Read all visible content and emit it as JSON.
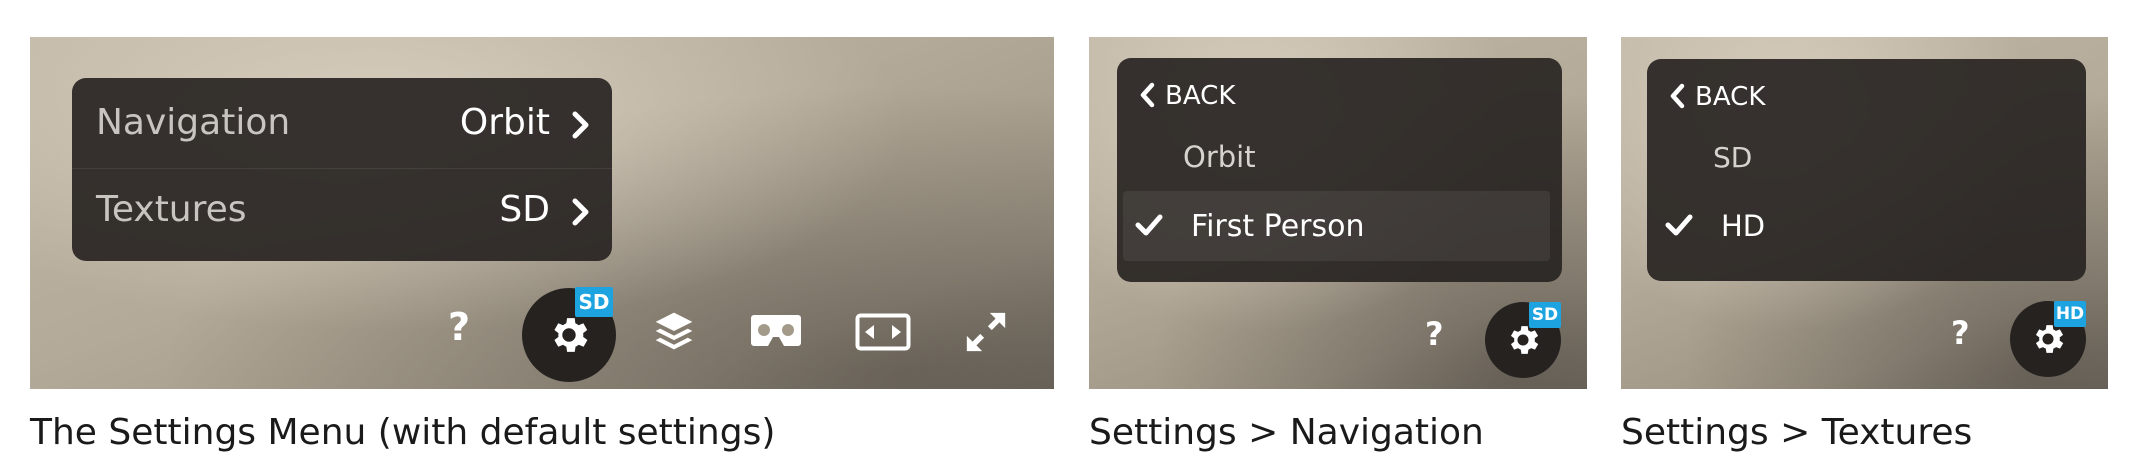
{
  "panel1": {
    "menu": {
      "rows": [
        {
          "label": "Navigation",
          "value": "Orbit"
        },
        {
          "label": "Textures",
          "value": "SD"
        }
      ]
    },
    "toolbar": {
      "help_label": "?",
      "settings_badge": "SD",
      "icons": [
        "help-icon",
        "gear-icon",
        "layers-icon",
        "vr-headset-icon",
        "fit-width-icon",
        "fullscreen-icon"
      ]
    },
    "caption": "The Settings Menu (with default settings)"
  },
  "panel2": {
    "menu": {
      "back_label": "BACK",
      "options": [
        {
          "label": "Orbit",
          "selected": false
        },
        {
          "label": "First Person",
          "selected": true
        }
      ]
    },
    "toolbar": {
      "help_label": "?",
      "settings_badge": "SD"
    },
    "caption": "Settings > Navigation"
  },
  "panel3": {
    "menu": {
      "back_label": "BACK",
      "options": [
        {
          "label": "SD",
          "selected": false
        },
        {
          "label": "HD",
          "selected": true
        }
      ]
    },
    "toolbar": {
      "help_label": "?",
      "settings_badge": "HD"
    },
    "caption": "Settings > Textures"
  },
  "colors": {
    "badge": "#1da3e0",
    "menu_bg": "#282422",
    "accent_text": "#ffffff"
  }
}
